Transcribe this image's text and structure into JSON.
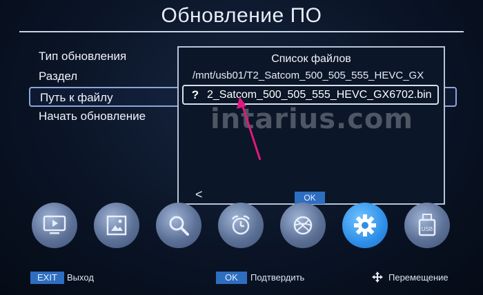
{
  "title": "Обновление ПО",
  "menu": {
    "items": [
      {
        "label": "Тип обновления"
      },
      {
        "label": "Раздел"
      },
      {
        "label": "Путь к файлу"
      },
      {
        "label": "Начать обновление"
      }
    ],
    "selected_index": 2
  },
  "dialog": {
    "title": "Список файлов",
    "path": "/mnt/usb01/T2_Satcom_500_505_555_HEVC_GX",
    "file": {
      "icon": "?",
      "name": "2_Satcom_500_505_555_HEVC_GX6702.bin"
    },
    "back": "<",
    "ok": "OK"
  },
  "watermark": "intarius.com",
  "icons": [
    "tv-icon",
    "picture-icon",
    "search-icon",
    "alarm-clock-icon",
    "ball-icon",
    "gear-icon",
    "usb-icon"
  ],
  "active_icon": "gear-icon",
  "bottom": {
    "exit_key": "EXIT",
    "exit_label": "Выход",
    "ok_key": "OK",
    "ok_label": "Подтвердить",
    "move_label": "Перемещение"
  },
  "colors": {
    "accent": "#2e6ec0",
    "active_icon": "#2f8fe8",
    "arrow": "#e0197d"
  }
}
